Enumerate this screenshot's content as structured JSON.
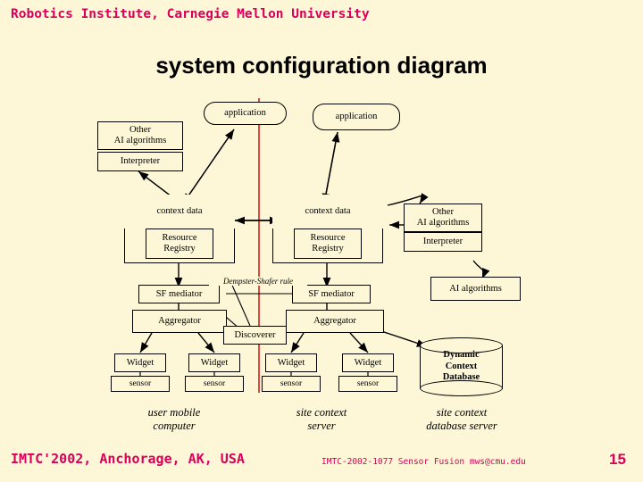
{
  "header": {
    "institute": "Robotics Institute, Carnegie Mellon University"
  },
  "title": "system configuration diagram",
  "footer": {
    "left": "IMTC'2002, Anchorage, AK, USA",
    "center": "IMTC-2002-1077 Sensor Fusion mws@cmu.edu",
    "page": "15"
  },
  "colors": {
    "background": "#fdf7d7",
    "accent": "#d8005a",
    "divider": "#cc0000",
    "line": "#000000"
  },
  "diagram": {
    "boxes": [
      {
        "id": "app1",
        "label": "application"
      },
      {
        "id": "app2",
        "label": "application"
      },
      {
        "id": "other_ai_left",
        "label": "Other\nAI algorithms"
      },
      {
        "id": "interpreter_left",
        "label": "Interpreter"
      },
      {
        "id": "context_data_1",
        "label": "context data"
      },
      {
        "id": "resource_registry_1",
        "label": "Resource\nRegistry"
      },
      {
        "id": "context_data_2",
        "label": "context data"
      },
      {
        "id": "resource_registry_2",
        "label": "Resource\nRegistry"
      },
      {
        "id": "other_ai_right",
        "label": "Other\nAI algorithms"
      },
      {
        "id": "interpreter_right",
        "label": "Interpreter"
      },
      {
        "id": "ai_algorithms_right",
        "label": "AI algorithms"
      },
      {
        "id": "sf_mediator_1",
        "label": "SF mediator"
      },
      {
        "id": "aggregator_1",
        "label": "Aggregator"
      },
      {
        "id": "sf_mediator_2",
        "label": "SF mediator"
      },
      {
        "id": "aggregator_2",
        "label": "Aggregator"
      },
      {
        "id": "discoverer",
        "label": "Discoverer"
      },
      {
        "id": "widget1",
        "label": "Widget"
      },
      {
        "id": "sensor1",
        "label": "sensor"
      },
      {
        "id": "widget2",
        "label": "Widget"
      },
      {
        "id": "sensor2",
        "label": "sensor"
      },
      {
        "id": "widget3",
        "label": "Widget"
      },
      {
        "id": "sensor3",
        "label": "sensor"
      },
      {
        "id": "widget4",
        "label": "Widget"
      },
      {
        "id": "sensor4",
        "label": "sensor"
      }
    ],
    "annotations": [
      {
        "id": "ds_rule",
        "label": "Dempster-Shafer rule"
      }
    ],
    "database": {
      "label": "Dynamic\nContext\nDatabase"
    },
    "captions": [
      {
        "id": "caption_user",
        "label": "user mobile\ncomputer"
      },
      {
        "id": "caption_site",
        "label": "site context\nserver"
      },
      {
        "id": "caption_db",
        "label": "site context\ndatabase server"
      }
    ]
  }
}
